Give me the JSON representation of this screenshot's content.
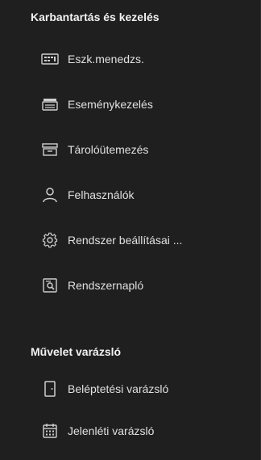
{
  "sections": [
    {
      "title": "Karbantartás és kezelés",
      "items": [
        {
          "label": "Eszk.menedzs.",
          "icon": "device-manager-icon"
        },
        {
          "label": "Eseménykezelés",
          "icon": "event-management-icon"
        },
        {
          "label": "Tárolóütemezés",
          "icon": "storage-schedule-icon"
        },
        {
          "label": "Felhasználók",
          "icon": "user-icon"
        },
        {
          "label": "Rendszer beállításai ...",
          "icon": "gear-icon"
        },
        {
          "label": "Rendszernapló",
          "icon": "system-log-icon"
        }
      ]
    },
    {
      "title": "Művelet varázsló",
      "items": [
        {
          "label": "Beléptetési varázsló",
          "icon": "door-access-icon"
        },
        {
          "label": "Jelenléti varázsló",
          "icon": "attendance-calendar-icon"
        }
      ]
    }
  ]
}
